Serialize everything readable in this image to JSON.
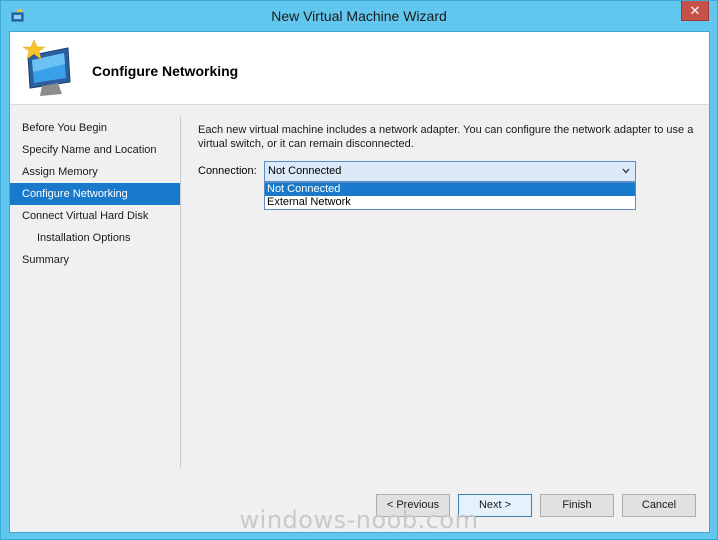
{
  "window": {
    "title": "New Virtual Machine Wizard",
    "close_glyph": "✕"
  },
  "header": {
    "title": "Configure Networking",
    "icon": "new-vm-wizard-icon"
  },
  "nav": {
    "items": [
      {
        "label": "Before You Begin",
        "active": false
      },
      {
        "label": "Specify Name and Location",
        "active": false
      },
      {
        "label": "Assign Memory",
        "active": false
      },
      {
        "label": "Configure Networking",
        "active": true
      },
      {
        "label": "Connect Virtual Hard Disk",
        "active": false
      },
      {
        "label": "Installation Options",
        "active": false,
        "indent": true
      },
      {
        "label": "Summary",
        "active": false
      }
    ]
  },
  "main": {
    "description": "Each new virtual machine includes a network adapter. You can configure the network adapter to use a virtual switch, or it can remain disconnected.",
    "connection_label": "Connection:",
    "connection_value": "Not Connected",
    "options": [
      "Not Connected",
      "External Network"
    ]
  },
  "buttons": {
    "previous": "< Previous",
    "next": "Next >",
    "finish": "Finish",
    "cancel": "Cancel"
  },
  "watermark": "windows-noob.com",
  "colors": {
    "title_bar": "#62c7ee",
    "selection": "#1979ca",
    "close_button": "#c7504a"
  }
}
